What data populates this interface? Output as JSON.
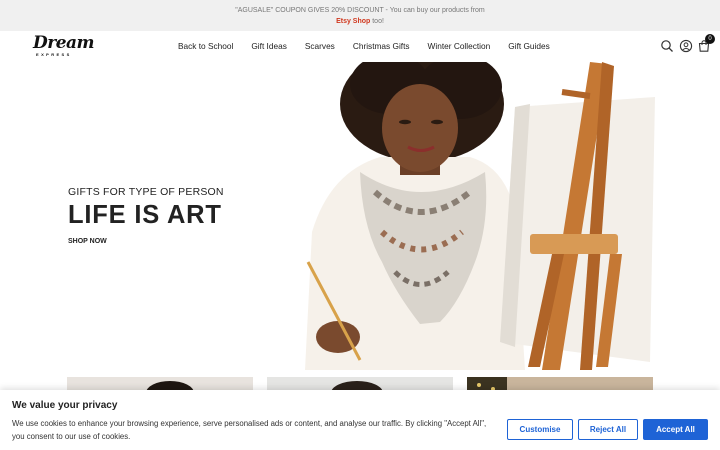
{
  "announcement": {
    "line1": "\"AGUSALE\" COUPON GIVES 20% DISCOUNT - You can buy our products from",
    "link": "Etsy Shop",
    "line2_suffix": " too!"
  },
  "brand": {
    "name": "Dream",
    "tagline": "EXPRESS"
  },
  "nav": [
    {
      "label": "Back to School"
    },
    {
      "label": "Gift Ideas"
    },
    {
      "label": "Scarves"
    },
    {
      "label": "Christmas Gifts"
    },
    {
      "label": "Winter Collection"
    },
    {
      "label": "Gift Guides"
    }
  ],
  "header_icons": [
    "search-icon",
    "account-icon",
    "cart-icon"
  ],
  "cart": {
    "count": "0"
  },
  "hero": {
    "eyebrow": "GIFTS FOR TYPE OF PERSON",
    "title": "LIFE IS ART",
    "cta": "SHOP NOW"
  },
  "cookie": {
    "title": "We value your privacy",
    "text": "We use cookies to enhance your browsing experience, serve personalised ads or content, and analyse our traffic. By clicking \"Accept All\", you consent to our use of cookies.",
    "customise": "Customise",
    "reject": "Reject All",
    "accept": "Accept All"
  },
  "colors": {
    "accent": "#1e63d6",
    "link": "#d0381e",
    "announce_bg": "#f0f0f0"
  }
}
